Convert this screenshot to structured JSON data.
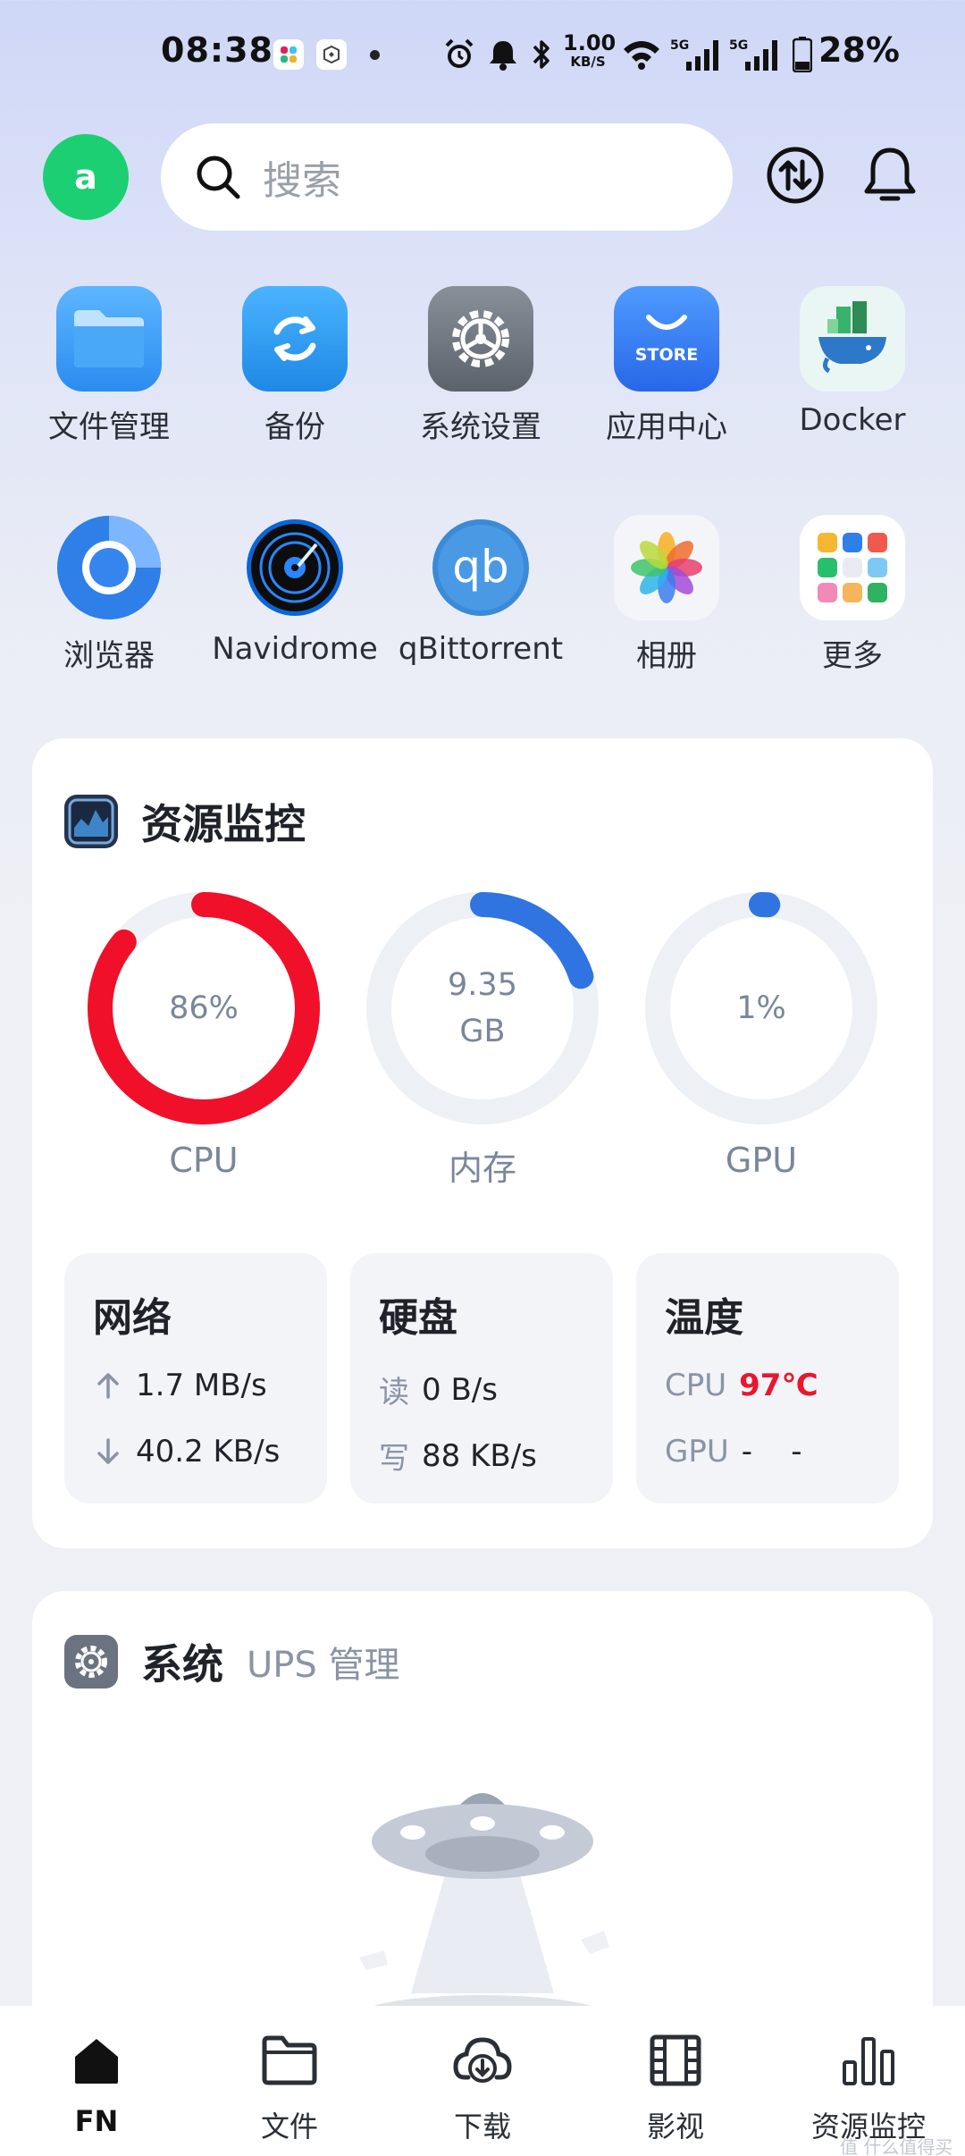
{
  "status_bar": {
    "time": "08:38",
    "net_speed_value": "1.00",
    "net_speed_unit": "KB/S",
    "battery_percent": "28%",
    "icons": [
      "alarm-icon",
      "bell-icon",
      "bluetooth-icon",
      "wifi-icon",
      "signal-5g-icon",
      "signal-5g-icon",
      "battery-icon"
    ]
  },
  "header": {
    "avatar_letter": "a",
    "search_placeholder": "搜索",
    "colors": {
      "avatar": "#1ccf73"
    }
  },
  "apps": [
    {
      "label": "文件管理",
      "icon": "folder-icon"
    },
    {
      "label": "备份",
      "icon": "backup-icon"
    },
    {
      "label": "系统设置",
      "icon": "settings-icon"
    },
    {
      "label": "应用中心",
      "icon": "store-icon",
      "icon_text": "STORE"
    },
    {
      "label": "Docker",
      "icon": "docker-icon"
    },
    {
      "label": "浏览器",
      "icon": "browser-icon"
    },
    {
      "label": "Navidrome",
      "icon": "navidrome-icon"
    },
    {
      "label": "qBittorrent",
      "icon": "qbittorrent-icon",
      "icon_text": "qb"
    },
    {
      "label": "相册",
      "icon": "photos-icon"
    },
    {
      "label": "更多",
      "icon": "more-apps-icon"
    }
  ],
  "resource_monitor": {
    "title": "资源监控",
    "gauges": [
      {
        "label": "CPU",
        "value": "86%",
        "fraction": 0.86,
        "color": "#f0102a"
      },
      {
        "label": "内存",
        "value": "9.35",
        "unit": "GB",
        "fraction": 0.2,
        "color": "#2f74e0"
      },
      {
        "label": "GPU",
        "value": "1%",
        "fraction": 0.01,
        "color": "#2f74e0"
      }
    ],
    "network": {
      "title": "网络",
      "up": "1.7 MB/s",
      "down": "40.2 KB/s"
    },
    "disk": {
      "title": "硬盘",
      "read_label": "读",
      "read": "0 B/s",
      "write_label": "写",
      "write": "88 KB/s"
    },
    "temperature": {
      "title": "温度",
      "cpu_label": "CPU",
      "cpu": "97℃",
      "gpu_label": "GPU",
      "gpu": "-    -"
    }
  },
  "system": {
    "title": "系统",
    "subtitle": "UPS 管理"
  },
  "bottom_nav": [
    {
      "label": "FN",
      "icon": "home-icon",
      "active": true
    },
    {
      "label": "文件",
      "icon": "folder-icon",
      "active": false
    },
    {
      "label": "下载",
      "icon": "download-icon",
      "active": false
    },
    {
      "label": "影视",
      "icon": "film-icon",
      "active": false
    },
    {
      "label": "资源监控",
      "icon": "bar-chart-icon",
      "active": false
    }
  ],
  "watermark": "值 什么值得买"
}
